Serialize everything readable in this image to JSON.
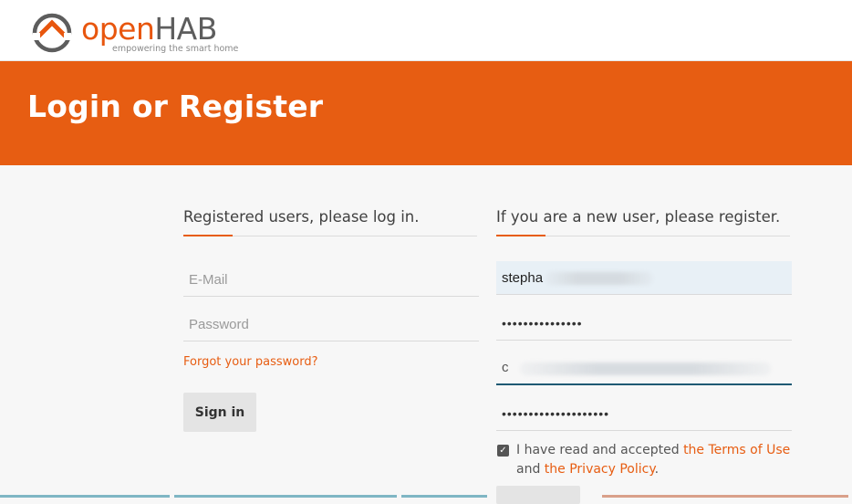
{
  "header": {
    "logo_open": "open",
    "logo_hab": "HAB",
    "logo_tagline": "empowering the smart home"
  },
  "banner": {
    "title": "Login or Register"
  },
  "login": {
    "heading": "Registered users, please log in.",
    "email_placeholder": "E-Mail",
    "password_placeholder": "Password",
    "forgot_link": "Forgot your password?",
    "signin_label": "Sign in"
  },
  "register": {
    "heading": "If you are a new user, please register.",
    "username_value": "stepha",
    "password_value": "•••••••••••••••",
    "email_value": "c",
    "confirm_password_value": "••••••••••••••••••••",
    "terms_checked": true,
    "terms_prefix": "I have read and accepted",
    "terms_link": "the Terms of Use",
    "terms_and": "and",
    "privacy_link": "the Privacy Policy",
    "terms_suffix": "."
  },
  "colors": {
    "brand_orange": "#e75d12",
    "field_focus_blue": "#1f5a73"
  }
}
